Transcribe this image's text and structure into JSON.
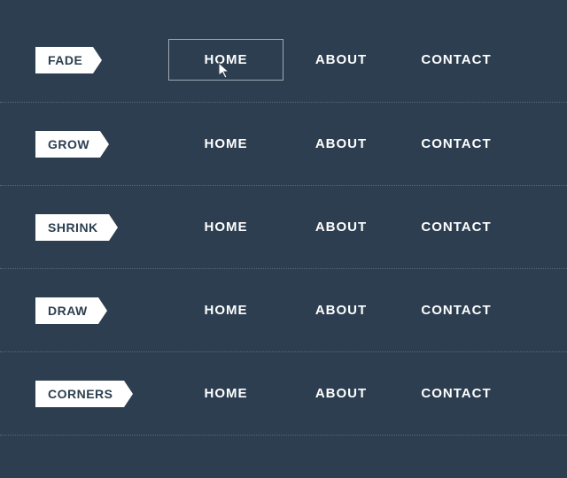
{
  "rows": [
    {
      "label": "FADE",
      "items": [
        "HOME",
        "ABOUT",
        "CONTACT"
      ],
      "activeIndex": 0
    },
    {
      "label": "GROW",
      "items": [
        "HOME",
        "ABOUT",
        "CONTACT"
      ],
      "activeIndex": null
    },
    {
      "label": "SHRINK",
      "items": [
        "HOME",
        "ABOUT",
        "CONTACT"
      ],
      "activeIndex": null
    },
    {
      "label": "DRAW",
      "items": [
        "HOME",
        "ABOUT",
        "CONTACT"
      ],
      "activeIndex": null
    },
    {
      "label": "CORNERS",
      "items": [
        "HOME",
        "ABOUT",
        "CONTACT"
      ],
      "activeIndex": null
    }
  ],
  "colors": {
    "background": "#2c3e50",
    "tag_bg": "#ffffff",
    "text": "#ffffff"
  }
}
